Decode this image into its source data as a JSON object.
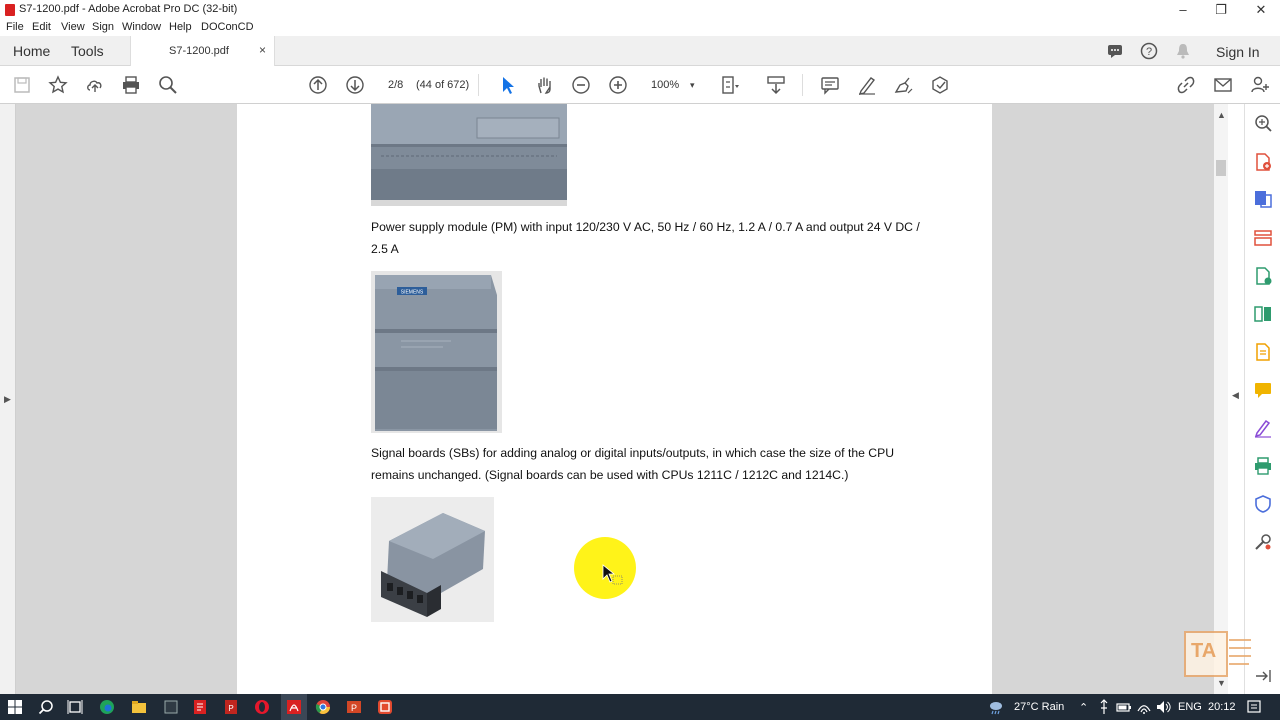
{
  "window": {
    "title": "S7-1200.pdf - Adobe Acrobat Pro DC (32-bit)",
    "minimize": "–",
    "maximize": "❐",
    "close": "✕"
  },
  "menu": [
    "File",
    "Edit",
    "View",
    "Sign",
    "Window",
    "Help",
    "DOConCD"
  ],
  "tabs": {
    "home": "Home",
    "tools": "Tools",
    "document": "S7-1200.pdf",
    "close": "×"
  },
  "header_right": {
    "sign_in": "Sign In"
  },
  "toolbar": {
    "page_current": "2/8",
    "page_total": "(44 of 672)",
    "zoom": "100%",
    "zoom_caret": "▾"
  },
  "document": {
    "para1": "Power supply module (PM) with input 120/230 V AC, 50 Hz / 60 Hz, 1.2 A / 0.7 A and output 24 V DC / 2.5 A",
    "para2": "Signal boards (SBs) for adding analog or digital inputs/outputs, in which case the size of the CPU remains unchanged. (Signal boards can be used with CPUs 1211C / 1212C and 1214C.)",
    "pm_brand": "SIEMENS"
  },
  "watermark": "TA",
  "taskbar": {
    "weather": "27°C  Rain",
    "language": "ENG",
    "time": "20:12"
  },
  "colors": {
    "accent_red": "#d92121",
    "highlight": "#fff200",
    "taskbar": "#1f2a36",
    "rightpanel_icons": "#e0503c"
  }
}
